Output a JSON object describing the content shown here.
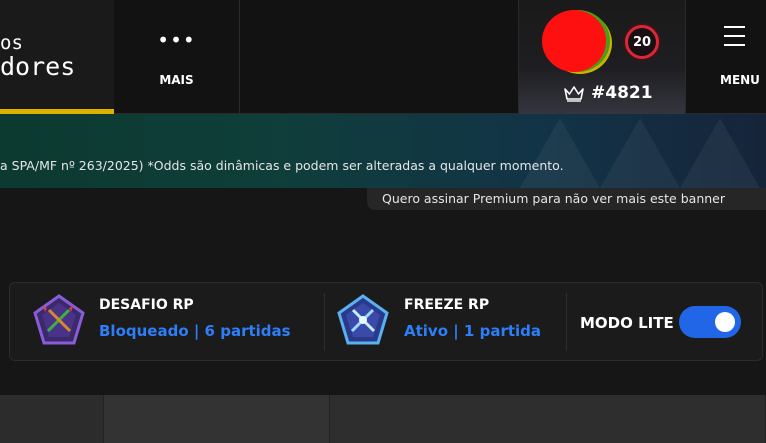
{
  "brand": {
    "line1": "os",
    "line2": "dores"
  },
  "nav": {
    "more_dots": "•••",
    "more_label": "MAIS",
    "menu_label": "MENU"
  },
  "profile": {
    "level": "20",
    "rank": "#4821"
  },
  "banner": {
    "text": "a SPA/MF nº 263/2025)  *Odds são dinâmicas e podem ser alteradas a qualquer momento."
  },
  "premium_note": "Quero assinar Premium para não ver mais este banner",
  "status": {
    "desafio": {
      "title": "DESAFIO RP",
      "value": "Bloqueado | 6 partidas"
    },
    "freeze": {
      "title": "FREEZE RP",
      "value": "Ativo | 1 partida"
    },
    "lite": {
      "label": "MODO LITE",
      "enabled": true
    }
  },
  "colors": {
    "accent_blue": "#2d7ff9",
    "toggle_on": "#2266e8",
    "brand_yellow": "#e0b000",
    "level_red": "#d8283a"
  }
}
